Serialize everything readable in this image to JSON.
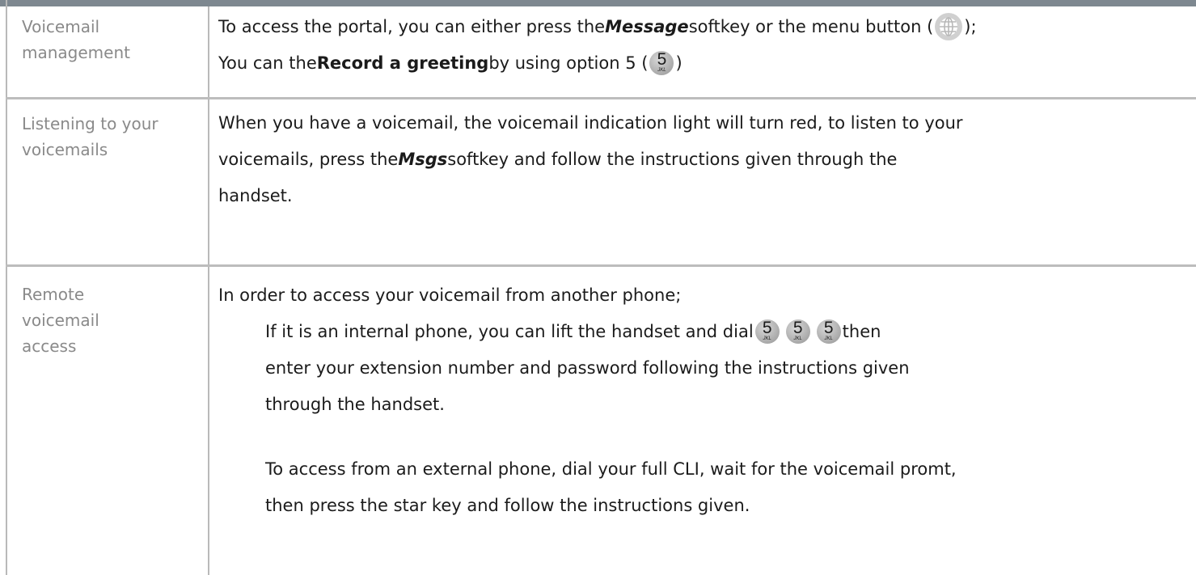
{
  "rows": [
    {
      "label_lines": [
        "Voicemail",
        "management"
      ],
      "content": {
        "line1": {
          "pre": "To access the portal, you can either press the ",
          "em": "Message",
          "mid": " softkey or the menu button (",
          "post": ");"
        },
        "line2": {
          "pre": "You can the ",
          "bold": "Record a greeting",
          "mid": " by using option 5 (",
          "post": ")"
        }
      }
    },
    {
      "label_lines": [
        "Listening to your",
        "voicemails"
      ],
      "content": {
        "line1": "When you have a voicemail, the voicemail indication light will turn red, to listen to your",
        "line2": {
          "pre": "voicemails, press the ",
          "em": "Msgs",
          "post": " softkey and follow the instructions given through the"
        },
        "line3": "handset."
      }
    },
    {
      "label_lines": [
        "Remote",
        "voicemail",
        "access"
      ],
      "content": {
        "line1": "In order to access your voicemail from another phone;",
        "line2": {
          "pre": "If it is an internal phone, you can lift the handset and dial ",
          "post": " then"
        },
        "line3": "enter your extension number and password following the instructions given",
        "line4": "through the handset.",
        "line5": "To access from an external phone, dial your full CLI, wait for the voicemail promt,",
        "line6": "then press the star key and follow the instructions given."
      }
    }
  ],
  "keys": {
    "digit": "5",
    "letters": "JKL"
  },
  "icons": {
    "menu": "menu-button-icon",
    "key": "keypad-5-icon"
  },
  "colors": {
    "header_bar": "#7e8890",
    "grid": "#b9b9b9",
    "label_text": "#8a8a8a",
    "body_text": "#1b1b1b"
  }
}
